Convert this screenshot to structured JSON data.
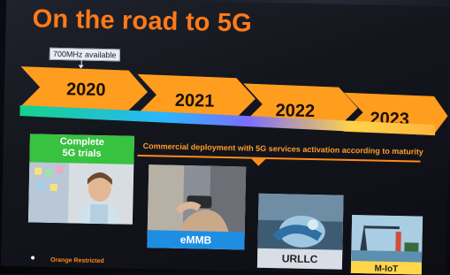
{
  "slide": {
    "title": "On the road to 5G",
    "callout": "700MHz available",
    "timeline": [
      {
        "year": "2020"
      },
      {
        "year": "2021"
      },
      {
        "year": "2022"
      },
      {
        "year": "2023"
      }
    ],
    "deployment_text": "Commercial deployment with 5G services activation according to maturity",
    "cards": [
      {
        "label": "Complete\n5G trials"
      },
      {
        "label": "eMMB"
      },
      {
        "label": "URLLC"
      },
      {
        "label": "M-IoT"
      }
    ],
    "footer": "Orange Restricted"
  },
  "colors": {
    "brand_orange": "#ff7a1a",
    "chevron_orange": "#ff9d1f",
    "label_blue": "#1e8ee3",
    "trials_green": "#37c23f",
    "mIoT_yellow": "#ffd54a"
  }
}
